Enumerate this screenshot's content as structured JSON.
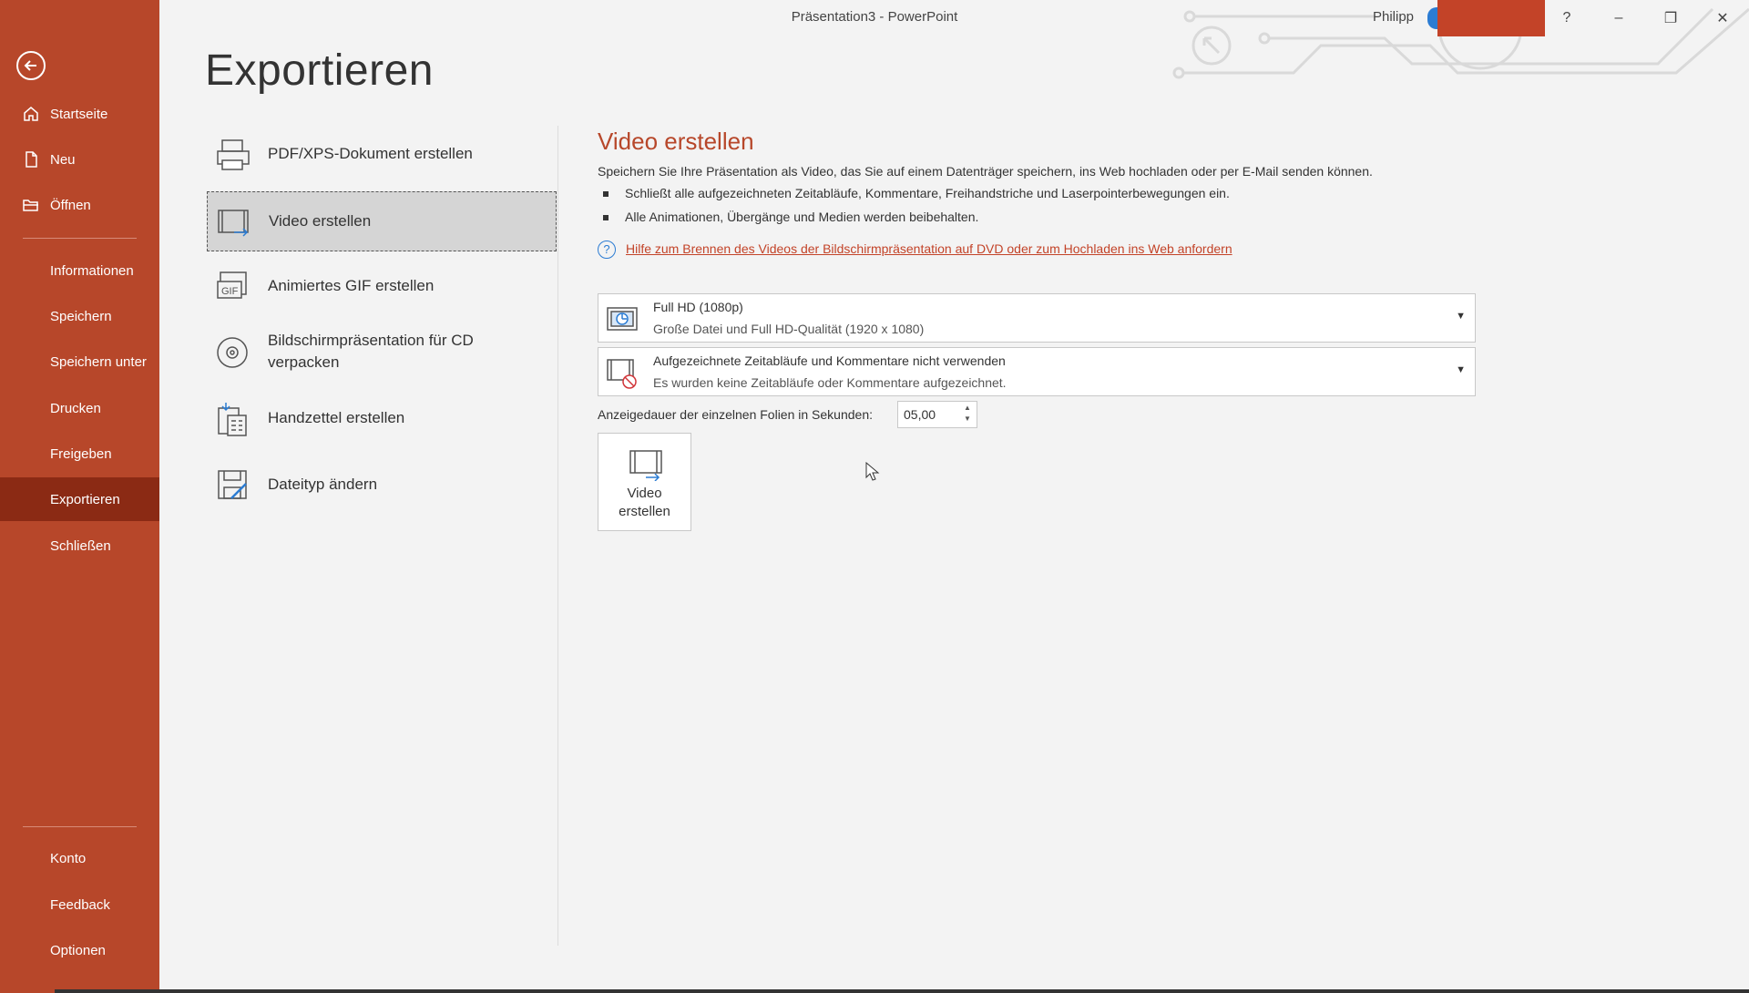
{
  "window": {
    "title": "Präsentation3  -  PowerPoint",
    "user": "Philipp",
    "controls": {
      "help": "?",
      "minimize": "–",
      "restore": "❐",
      "close": "✕"
    }
  },
  "sidebar": {
    "items": [
      {
        "label": "Startseite",
        "icon": "home-icon"
      },
      {
        "label": "Neu",
        "icon": "new-document-icon"
      },
      {
        "label": "Öffnen",
        "icon": "folder-open-icon"
      },
      {
        "label": "Informationen"
      },
      {
        "label": "Speichern"
      },
      {
        "label": "Speichern unter"
      },
      {
        "label": "Drucken"
      },
      {
        "label": "Freigeben"
      },
      {
        "label": "Exportieren",
        "active": true
      },
      {
        "label": "Schließen"
      }
    ],
    "bottom_items": [
      {
        "label": "Konto"
      },
      {
        "label": "Feedback"
      },
      {
        "label": "Optionen"
      }
    ]
  },
  "page": {
    "title": "Exportieren"
  },
  "export_options": [
    {
      "label": "PDF/XPS-Dokument erstellen",
      "icon": "pdf-document-icon"
    },
    {
      "label": "Video erstellen",
      "icon": "video-film-icon",
      "selected": true
    },
    {
      "label": "Animiertes GIF erstellen",
      "icon": "gif-icon"
    },
    {
      "label": "Bildschirmpräsentation für CD verpacken",
      "icon": "cd-disc-icon"
    },
    {
      "label": "Handzettel erstellen",
      "icon": "handout-icon"
    },
    {
      "label": "Dateityp ändern",
      "icon": "change-file-type-icon"
    }
  ],
  "video_panel": {
    "title": "Video erstellen",
    "description": "Speichern Sie Ihre Präsentation als Video, das Sie auf einem Datenträger speichern, ins Web hochladen oder per E-Mail senden können.",
    "bullets": [
      "Schließt alle aufgezeichneten Zeitabläufe, Kommentare, Freihandstriche und Laserpointerbewegungen ein.",
      "Alle Animationen, Übergänge und Medien werden beibehalten."
    ],
    "help_link": "Hilfe zum Brennen des Videos der Bildschirmpräsentation auf DVD oder zum Hochladen ins Web anfordern",
    "quality_dropdown": {
      "title": "Full HD (1080p)",
      "subtitle": "Große Datei und Full HD-Qualität (1920 x 1080)"
    },
    "timing_dropdown": {
      "title": "Aufgezeichnete Zeitabläufe und Kommentare nicht verwenden",
      "subtitle": "Es wurden keine Zeitabläufe oder Kommentare aufgezeichnet."
    },
    "duration_label": "Anzeigedauer der einzelnen Folien in Sekunden:",
    "duration_value": "05,00",
    "create_button_line1": "Video",
    "create_button_line2": "erstellen"
  },
  "colors": {
    "accent": "#b7472a",
    "active_nav": "#8b2a14",
    "link": "#c34328",
    "info_blue": "#2b7cd3"
  }
}
